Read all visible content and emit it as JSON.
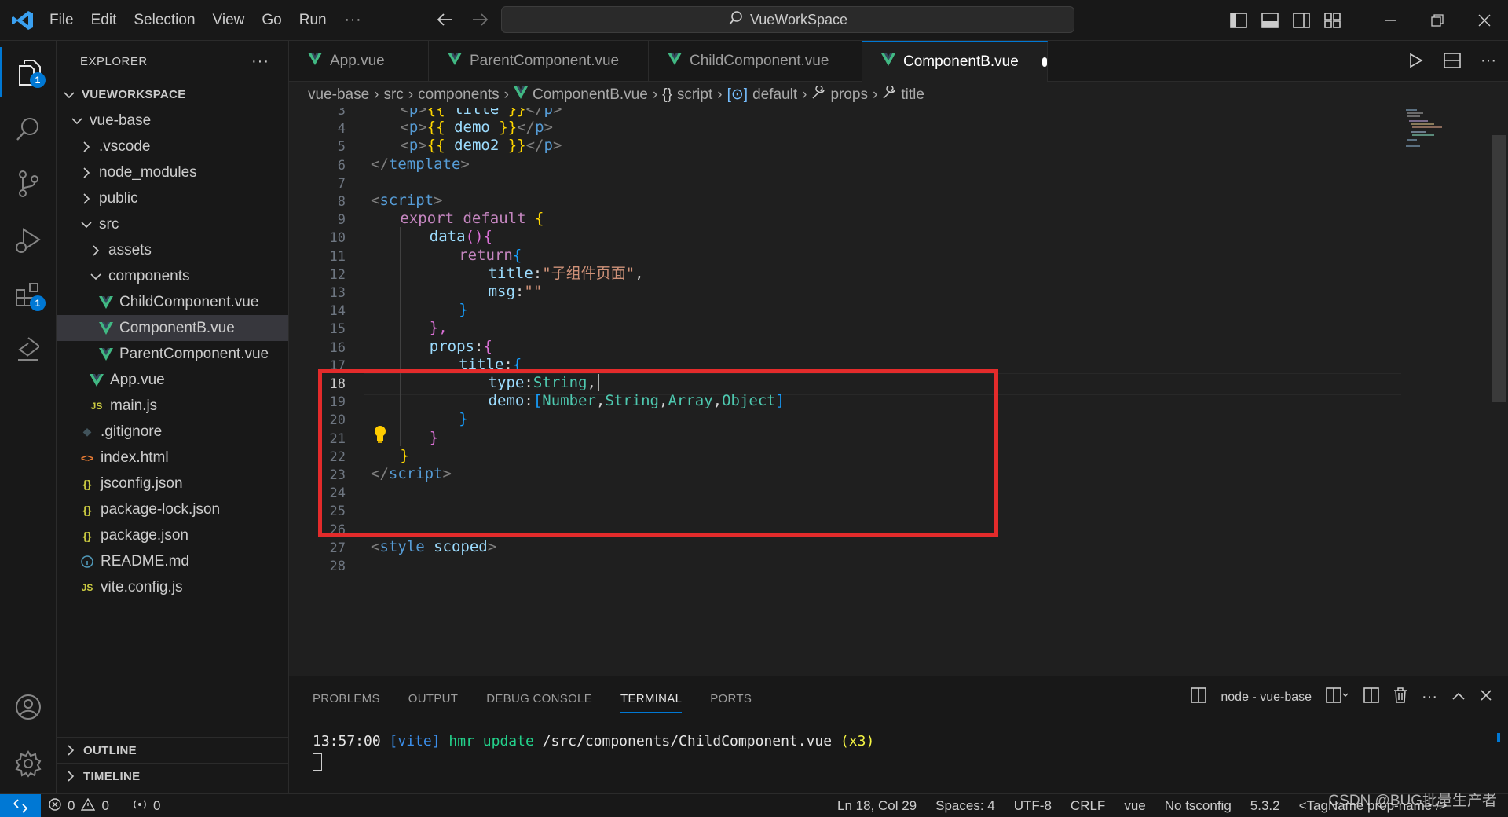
{
  "titlebar": {
    "menu": [
      "File",
      "Edit",
      "Selection",
      "View",
      "Go",
      "Run"
    ],
    "more": "···",
    "search_text": "VueWorkSpace"
  },
  "activity": {
    "explorer_badge": "1",
    "extensions_badge": "1"
  },
  "sidebar": {
    "title": "EXPLORER",
    "more": "···",
    "root": "VUEWORKSPACE",
    "tree": [
      {
        "label": "vue-base",
        "type": "folder-open"
      },
      {
        "label": ".vscode",
        "type": "folder"
      },
      {
        "label": "node_modules",
        "type": "folder"
      },
      {
        "label": "public",
        "type": "folder"
      },
      {
        "label": "src",
        "type": "folder-open"
      },
      {
        "label": "assets",
        "type": "folder"
      },
      {
        "label": "components",
        "type": "folder-open"
      },
      {
        "label": "ChildComponent.vue",
        "type": "vue"
      },
      {
        "label": "ComponentB.vue",
        "type": "vue",
        "selected": true
      },
      {
        "label": "ParentComponent.vue",
        "type": "vue"
      },
      {
        "label": "App.vue",
        "type": "vue"
      },
      {
        "label": "main.js",
        "type": "js"
      },
      {
        "label": ".gitignore",
        "type": "git"
      },
      {
        "label": "index.html",
        "type": "html"
      },
      {
        "label": "jsconfig.json",
        "type": "json"
      },
      {
        "label": "package-lock.json",
        "type": "json"
      },
      {
        "label": "package.json",
        "type": "json"
      },
      {
        "label": "README.md",
        "type": "info"
      },
      {
        "label": "vite.config.js",
        "type": "js"
      }
    ],
    "outline": "OUTLINE",
    "timeline": "TIMELINE"
  },
  "tabs": [
    {
      "label": "App.vue",
      "active": false
    },
    {
      "label": "ParentComponent.vue",
      "active": false
    },
    {
      "label": "ChildComponent.vue",
      "active": false
    },
    {
      "label": "ComponentB.vue",
      "active": true,
      "modified": true
    }
  ],
  "breadcrumb": {
    "parts": [
      "vue-base",
      "src",
      "components",
      "ComponentB.vue",
      "script",
      "default",
      "props",
      "title"
    ]
  },
  "editor": {
    "current_line": 18,
    "lines": [
      {
        "n": "3",
        "code": [
          [
            "tg",
            "<"
          ],
          [
            "tn",
            "p"
          ],
          [
            "tg",
            ">"
          ],
          [
            "ty",
            "{{ "
          ],
          [
            "tv",
            "title"
          ],
          [
            "ty",
            " }}"
          ],
          [
            "tg",
            "</"
          ],
          [
            "tn",
            "p"
          ],
          [
            "tg",
            ">"
          ]
        ],
        "indent": 1
      },
      {
        "n": "4",
        "code": [
          [
            "tg",
            "<"
          ],
          [
            "tn",
            "p"
          ],
          [
            "tg",
            ">"
          ],
          [
            "ty",
            "{{ "
          ],
          [
            "tv",
            "demo"
          ],
          [
            "ty",
            " }}"
          ],
          [
            "tg",
            "</"
          ],
          [
            "tn",
            "p"
          ],
          [
            "tg",
            ">"
          ]
        ],
        "indent": 1
      },
      {
        "n": "5",
        "code": [
          [
            "tg",
            "<"
          ],
          [
            "tn",
            "p"
          ],
          [
            "tg",
            ">"
          ],
          [
            "ty",
            "{{ "
          ],
          [
            "tv",
            "demo2"
          ],
          [
            "ty",
            " }}"
          ],
          [
            "tg",
            "</"
          ],
          [
            "tn",
            "p"
          ],
          [
            "tg",
            ">"
          ]
        ],
        "indent": 1
      },
      {
        "n": "6",
        "code": [
          [
            "tg",
            "</"
          ],
          [
            "tn",
            "template"
          ],
          [
            "tg",
            ">"
          ]
        ],
        "indent": 0
      },
      {
        "n": "7",
        "code": [],
        "indent": 0
      },
      {
        "n": "8",
        "code": [
          [
            "tg",
            "<"
          ],
          [
            "tn",
            "script"
          ],
          [
            "tg",
            ">"
          ]
        ],
        "indent": 0
      },
      {
        "n": "9",
        "code": [
          [
            "tk",
            "export"
          ],
          [
            "tw",
            " "
          ],
          [
            "tk",
            "default"
          ],
          [
            "tw",
            " "
          ],
          [
            "ty",
            "{"
          ]
        ],
        "indent": 1
      },
      {
        "n": "10",
        "code": [
          [
            "tv",
            "data"
          ],
          [
            "tp",
            "()"
          ],
          [
            "tp",
            "{"
          ]
        ],
        "indent": 2
      },
      {
        "n": "11",
        "code": [
          [
            "tk",
            "return"
          ],
          [
            "tb",
            "{"
          ]
        ],
        "indent": 3
      },
      {
        "n": "12",
        "code": [
          [
            "tv",
            "title"
          ],
          [
            "tw",
            ":"
          ],
          [
            "ts",
            "\"子组件页面\""
          ],
          [
            "tw",
            ","
          ]
        ],
        "indent": 4
      },
      {
        "n": "13",
        "code": [
          [
            "tv",
            "msg"
          ],
          [
            "tw",
            ":"
          ],
          [
            "ts",
            "\"\""
          ]
        ],
        "indent": 4
      },
      {
        "n": "14",
        "code": [
          [
            "tb",
            "}"
          ]
        ],
        "indent": 3
      },
      {
        "n": "15",
        "code": [
          [
            "tp",
            "},"
          ]
        ],
        "indent": 2
      },
      {
        "n": "16",
        "code": [
          [
            "tv",
            "props"
          ],
          [
            "tw",
            ":"
          ],
          [
            "tp",
            "{"
          ]
        ],
        "indent": 2
      },
      {
        "n": "17",
        "code": [
          [
            "tv",
            "title"
          ],
          [
            "tw",
            ":"
          ],
          [
            "tb",
            "{"
          ]
        ],
        "indent": 3
      },
      {
        "n": "18",
        "code": [
          [
            "tv",
            "type"
          ],
          [
            "tw",
            ":"
          ],
          [
            "tt",
            "String"
          ],
          [
            "tw",
            ","
          ]
        ],
        "indent": 4
      },
      {
        "n": "19",
        "code": [
          [
            "tv",
            "demo"
          ],
          [
            "tw",
            ":"
          ],
          [
            "tb",
            "["
          ],
          [
            "tt",
            "Number"
          ],
          [
            "tw",
            ","
          ],
          [
            "tt",
            "String"
          ],
          [
            "tw",
            ","
          ],
          [
            "tt",
            "Array"
          ],
          [
            "tw",
            ","
          ],
          [
            "tt",
            "Object"
          ],
          [
            "tb",
            "]"
          ]
        ],
        "indent": 4
      },
      {
        "n": "20",
        "code": [
          [
            "tb",
            "}"
          ]
        ],
        "indent": 3
      },
      {
        "n": "21",
        "code": [
          [
            "tp",
            "}"
          ]
        ],
        "indent": 2
      },
      {
        "n": "22",
        "code": [
          [
            "ty",
            "}"
          ]
        ],
        "indent": 1
      },
      {
        "n": "23",
        "code": [
          [
            "tg",
            "</"
          ],
          [
            "tn",
            "script"
          ],
          [
            "tg",
            ">"
          ]
        ],
        "indent": 0
      },
      {
        "n": "24",
        "code": [],
        "indent": 0
      },
      {
        "n": "25",
        "code": [],
        "indent": 0
      },
      {
        "n": "26",
        "code": [],
        "indent": 0
      },
      {
        "n": "27",
        "code": [
          [
            "tg",
            "<"
          ],
          [
            "tn",
            "style"
          ],
          [
            "tw",
            " "
          ],
          [
            "tv",
            "scoped"
          ],
          [
            "tg",
            ">"
          ]
        ],
        "indent": 0
      },
      {
        "n": "28",
        "code": [],
        "indent": 0
      }
    ]
  },
  "panel": {
    "tabs": [
      "PROBLEMS",
      "OUTPUT",
      "DEBUG CONSOLE",
      "TERMINAL",
      "PORTS"
    ],
    "active_tab": "TERMINAL",
    "terminal_name": "node - vue-base",
    "terminal_time": "13:57:00",
    "terminal_tag": "[vite]",
    "terminal_msg": "hmr update",
    "terminal_path": "/src/components/ChildComponent.vue",
    "terminal_count": "(x3)"
  },
  "statusbar": {
    "errors": "0",
    "warnings": "0",
    "ports": "0",
    "position": "Ln 18, Col 29",
    "spaces": "Spaces: 4",
    "encoding": "UTF-8",
    "eol": "CRLF",
    "language": "vue",
    "tsconfig": "No tsconfig",
    "version": "5.3.2",
    "tagname": "<TagName prop-name />"
  },
  "watermark": "CSDN @BUG批量生产者"
}
